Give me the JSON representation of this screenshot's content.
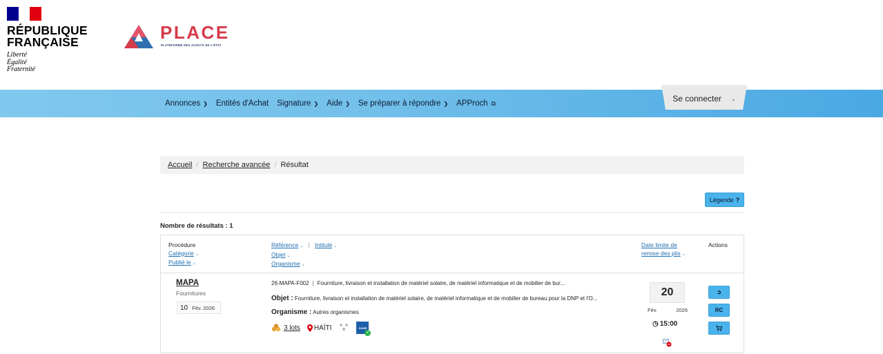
{
  "header": {
    "republic_line1": "RÉPUBLIQUE",
    "republic_line2": "FRANÇAISE",
    "motto": [
      "Liberté",
      "Égalité",
      "Fraternité"
    ],
    "brand": "PLACE",
    "brand_subtitle": "PLATEFORME DES ACHATS DE L'ÉTAT"
  },
  "nav": {
    "items": [
      {
        "label": "Annonces",
        "chevron": true
      },
      {
        "label": "Entités d'Achat",
        "chevron": false
      },
      {
        "label": "Signature",
        "chevron": true
      },
      {
        "label": "Aide",
        "chevron": true
      },
      {
        "label": "Se préparer à répondre",
        "chevron": true
      },
      {
        "label": "APProch",
        "chevron": false,
        "external": true
      }
    ],
    "login_label": "Se connecter"
  },
  "breadcrumb": {
    "home": "Accueil",
    "advanced": "Recherche avancée",
    "current": "Résultat"
  },
  "legend_button": {
    "label": "Légende",
    "icon": "?"
  },
  "results": {
    "count_label": "Nombre de résultats : 1",
    "headers": {
      "procedure": "Procédure",
      "category": "Catégorie",
      "published": "Publié le",
      "reference": "Référence",
      "title": "Intitulé",
      "object": "Objet",
      "organism": "Organisme",
      "deadline_line1": "Date limite de",
      "deadline_line2": "remise des plis",
      "actions": "Actions"
    },
    "rows": [
      {
        "procedure": "MAPA",
        "category": "Fournitures",
        "published_day": "10",
        "published_month_year": "Fév. 2026",
        "reference": "26-MAPA-F002",
        "title": "Fourniture, livraison et installation de matériel solaire, de matériel informatique et de mobilier de bur...",
        "object_label": "Objet :",
        "object": "Fourniture, livraison et installation de matériel solaire, de matériel informatique et de mobilier de bureau pour la DNP et l'O...",
        "organism_label": "Organisme :",
        "organism": "Autres organismes",
        "lots": "3 lots",
        "location": "HAÏTI",
        "dume": "DUME",
        "deadline_day": "20",
        "deadline_month": "Fév.",
        "deadline_year": "2026",
        "deadline_time": "15:00",
        "actions": [
          "login",
          "RC",
          "cart"
        ]
      }
    ]
  },
  "colors": {
    "nav_gradient_start": "#7fc8ee",
    "nav_gradient_end": "#4aa8e3",
    "button_blue": "#4bb3ec",
    "link_blue": "#1f6fb2",
    "brand_red": "#d63b4a"
  }
}
